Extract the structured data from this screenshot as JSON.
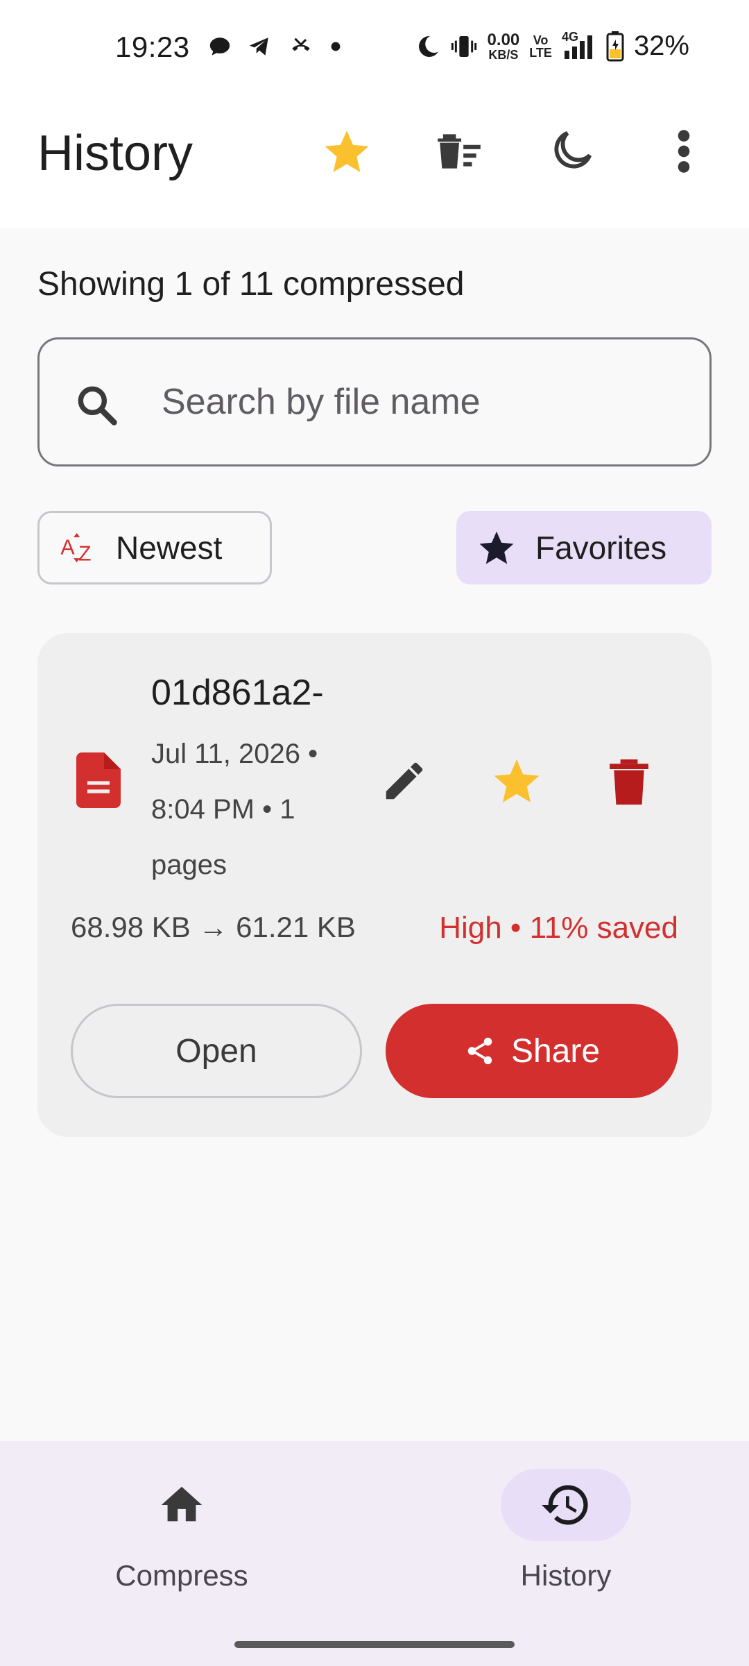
{
  "status_bar": {
    "time": "19:23",
    "net_speed_value": "0.00",
    "net_speed_unit": "KB/S",
    "volte_top": "Vo",
    "volte_bottom": "LTE",
    "network": "4G",
    "battery_percent": "32%"
  },
  "app_bar": {
    "title": "History",
    "icons": [
      "star-icon",
      "delete-sweep-icon",
      "dark-mode-icon",
      "more-vert-icon"
    ],
    "accent_star_color": "#fbc02d"
  },
  "summary": {
    "showing_text": "Showing 1 of 11 compressed"
  },
  "search": {
    "placeholder": "Search by file name",
    "value": ""
  },
  "filters": {
    "sort_label": "Newest",
    "favorites_label": "Favorites",
    "favorites_selected": true
  },
  "history_items": [
    {
      "file_name": "01d861a2-",
      "meta_date": "Jul 11, 2026 •",
      "meta_time": "8:04 PM • 1",
      "meta_pages": "pages",
      "size_text": "68.98 KB → 61.21 KB",
      "saved_text": "High • 11% saved",
      "is_favorite": true,
      "open_label": "Open",
      "share_label": "Share"
    }
  ],
  "bottom_nav": {
    "items": [
      {
        "label": "Compress",
        "icon": "home-icon",
        "selected": false
      },
      {
        "label": "History",
        "icon": "history-icon",
        "selected": true
      }
    ]
  },
  "colors": {
    "primary_red": "#d32f2f",
    "star_yellow": "#fbc02d",
    "selected_container": "#e8def8",
    "nav_background": "#f1ecf6"
  }
}
